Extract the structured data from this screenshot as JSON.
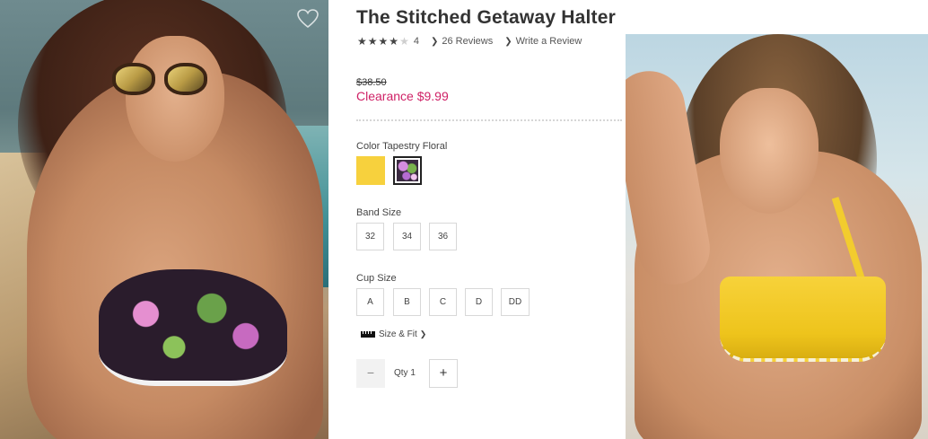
{
  "product": {
    "title": "The Stitched Getaway Halter",
    "rating": 4,
    "rating_max": 5,
    "rating_count_text": "4",
    "reviews_link": "26 Reviews",
    "write_review_link": "Write a Review",
    "price": {
      "original": "$38.50",
      "clearance": "Clearance $9.99",
      "clearance_color": "#cf2166"
    }
  },
  "color": {
    "label": "Color Tapestry Floral",
    "swatches": [
      {
        "name": "yellow",
        "color": "#f7d13d",
        "selected": false
      },
      {
        "name": "tapestry-floral",
        "selected": true
      }
    ]
  },
  "band_size": {
    "label": "Band Size",
    "options": [
      "32",
      "34",
      "36"
    ]
  },
  "cup_size": {
    "label": "Cup Size",
    "options": [
      "A",
      "B",
      "C",
      "D",
      "DD"
    ]
  },
  "size_fit": {
    "label": "Size & Fit",
    "icon": "ruler-icon"
  },
  "quantity": {
    "minus": "−",
    "label": "Qty 1",
    "plus": "+"
  },
  "icons": {
    "favorite": "heart-icon",
    "star": "star-icon",
    "chevron": "chevron-right-icon"
  }
}
